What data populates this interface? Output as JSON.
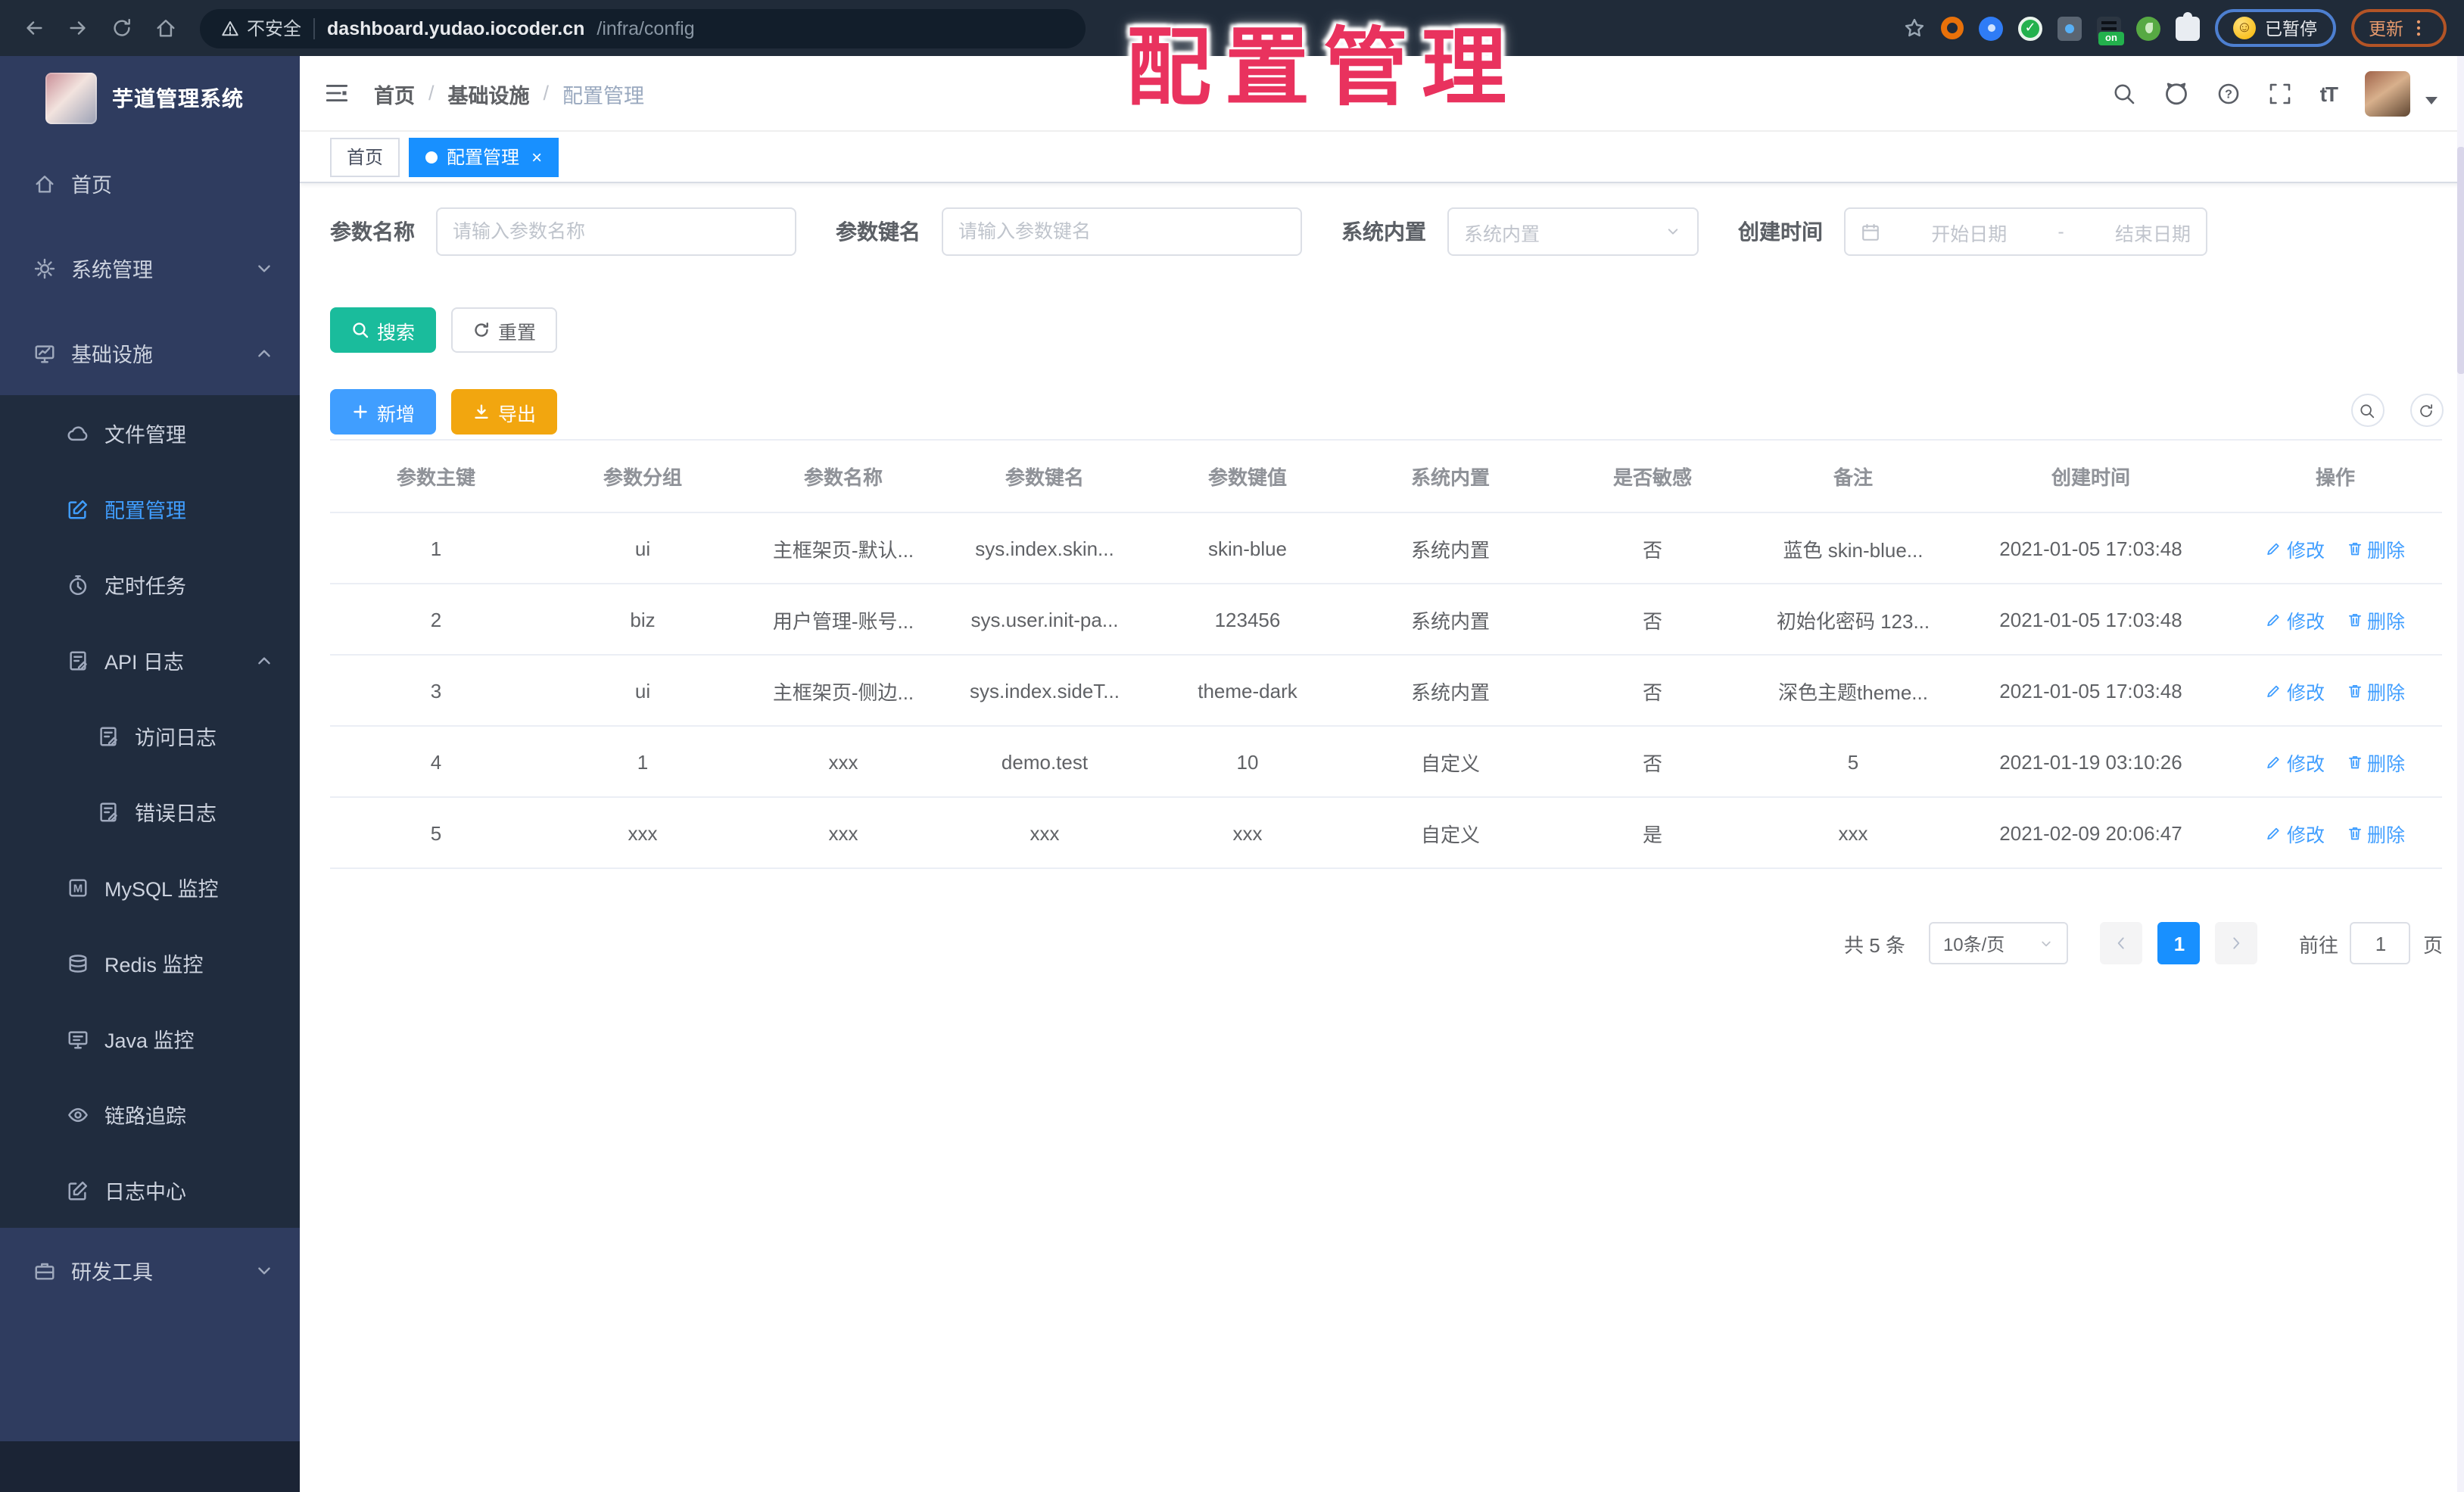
{
  "annotation": {
    "text": "配置管理"
  },
  "browser": {
    "security_label": "不安全",
    "url_host": "dashboard.yudao.iocoder.cn",
    "url_path": "/infra/config",
    "extensions": [
      "orange-ring-extension-icon",
      "pin-extension-icon",
      "check-extension-icon",
      "translate-extension-icon",
      "proxy-on-extension-icon",
      "leaf-extension-icon",
      "puzzle-extensions-icon"
    ],
    "proxy_badge": "on",
    "paused_badge": "已暂停",
    "update_button": "更新"
  },
  "sidebar": {
    "title": "芋道管理系统",
    "items": [
      {
        "label": "首页",
        "icon": "home",
        "level": 0,
        "sub": false
      },
      {
        "label": "系统管理",
        "icon": "gear",
        "level": 0,
        "sub": false,
        "chevron": "down"
      },
      {
        "label": "基础设施",
        "icon": "infra",
        "level": 0,
        "sub": false,
        "chevron": "up"
      },
      {
        "label": "文件管理",
        "icon": "cloud",
        "level": 1,
        "sub": true
      },
      {
        "label": "配置管理",
        "icon": "edit",
        "level": 1,
        "sub": true,
        "active": true
      },
      {
        "label": "定时任务",
        "icon": "timer",
        "level": 1,
        "sub": true
      },
      {
        "label": "API 日志",
        "icon": "log",
        "level": 1,
        "sub": true,
        "chevron": "up"
      },
      {
        "label": "访问日志",
        "icon": "doc",
        "level": 2,
        "sub": true
      },
      {
        "label": "错误日志",
        "icon": "doc",
        "level": 2,
        "sub": true
      },
      {
        "label": "MySQL 监控",
        "icon": "mysql",
        "level": 1,
        "sub": true
      },
      {
        "label": "Redis 监控",
        "icon": "redis",
        "level": 1,
        "sub": true
      },
      {
        "label": "Java 监控",
        "icon": "java",
        "level": 1,
        "sub": true
      },
      {
        "label": "链路追踪",
        "icon": "eye",
        "level": 1,
        "sub": true
      },
      {
        "label": "日志中心",
        "icon": "logcenter",
        "level": 1,
        "sub": true
      },
      {
        "label": "研发工具",
        "icon": "tools",
        "level": 0,
        "sub": false,
        "chevron": "down"
      }
    ]
  },
  "header": {
    "breadcrumb": [
      "首页",
      "基础设施",
      "配置管理"
    ],
    "font_size_label": "tT"
  },
  "tabs": [
    {
      "label": "首页",
      "active": false,
      "closable": false
    },
    {
      "label": "配置管理",
      "active": true,
      "closable": true
    }
  ],
  "filters": {
    "name": {
      "label": "参数名称",
      "placeholder": "请输入参数名称"
    },
    "key": {
      "label": "参数键名",
      "placeholder": "请输入参数键名"
    },
    "type": {
      "label": "系统内置",
      "placeholder": "系统内置"
    },
    "time": {
      "label": "创建时间",
      "start_placeholder": "开始日期",
      "separator": "-",
      "end_placeholder": "结束日期"
    },
    "search_label": "搜索",
    "reset_label": "重置"
  },
  "toolbar": {
    "add_label": "新增",
    "export_label": "导出"
  },
  "table": {
    "headers": [
      "参数主键",
      "参数分组",
      "参数名称",
      "参数键名",
      "参数键值",
      "系统内置",
      "是否敏感",
      "备注",
      "创建时间",
      "操作"
    ],
    "action_labels": [
      "修改",
      "删除"
    ],
    "rows": [
      [
        "1",
        "ui",
        "主框架页-默认...",
        "sys.index.skin...",
        "skin-blue",
        "系统内置",
        "否",
        "蓝色 skin-blue...",
        "2021-01-05 17:03:48"
      ],
      [
        "2",
        "biz",
        "用户管理-账号...",
        "sys.user.init-pa...",
        "123456",
        "系统内置",
        "否",
        "初始化密码 123...",
        "2021-01-05 17:03:48"
      ],
      [
        "3",
        "ui",
        "主框架页-侧边...",
        "sys.index.sideT...",
        "theme-dark",
        "系统内置",
        "否",
        "深色主题theme...",
        "2021-01-05 17:03:48"
      ],
      [
        "4",
        "1",
        "xxx",
        "demo.test",
        "10",
        "自定义",
        "否",
        "5",
        "2021-01-19 03:10:26"
      ],
      [
        "5",
        "xxx",
        "xxx",
        "xxx",
        "xxx",
        "自定义",
        "是",
        "xxx",
        "2021-02-09 20:06:47"
      ]
    ]
  },
  "pagination": {
    "total": "共 5 条",
    "page_size": "10条/页",
    "current": "1",
    "goto_label": "前往",
    "goto_value": "1",
    "page_label": "页"
  },
  "colors": {
    "accent_blue": "#409eff",
    "tab_blue": "#1890ff",
    "search_teal": "#1abc9c",
    "export_amber": "#f2a60f",
    "annotation_red": "#e9325e",
    "sidebar_bg": "#2f3c5f",
    "sidebar_submenu_bg": "#202c3e",
    "chrome_bg": "#202b39"
  }
}
